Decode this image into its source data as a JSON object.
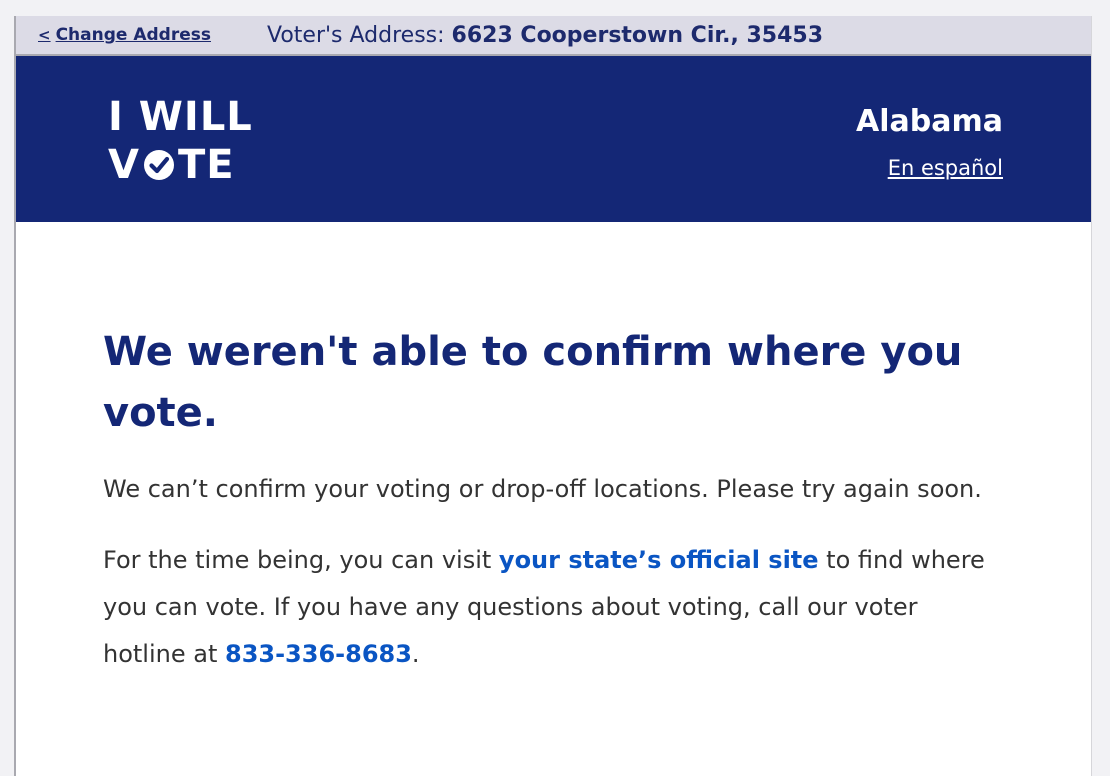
{
  "address_bar": {
    "change_label": "Change Address",
    "address_prefix": "Voter's Address: ",
    "address_value": "6623 Cooperstown Cir., 35453"
  },
  "header": {
    "logo_line1": "I WILL",
    "logo_line2_a": "V",
    "logo_line2_b": "TE",
    "state": "Alabama",
    "language_link": "En español"
  },
  "main": {
    "heading": "We weren't able to confirm where you vote.",
    "paragraph1": "We can’t confirm your voting or drop-off locations. Please try again soon.",
    "paragraph2_before": "For the time being, you can visit ",
    "paragraph2_link": "your state’s official site",
    "paragraph2_middle": " to find where you can vote. If you have any questions about voting, call our voter hotline at ",
    "paragraph2_phone": "833-336-8683",
    "paragraph2_after": "."
  },
  "colors": {
    "brand_navy": "#142776",
    "link_blue": "#0a55c3",
    "address_bar_bg": "#dcdbe6"
  }
}
